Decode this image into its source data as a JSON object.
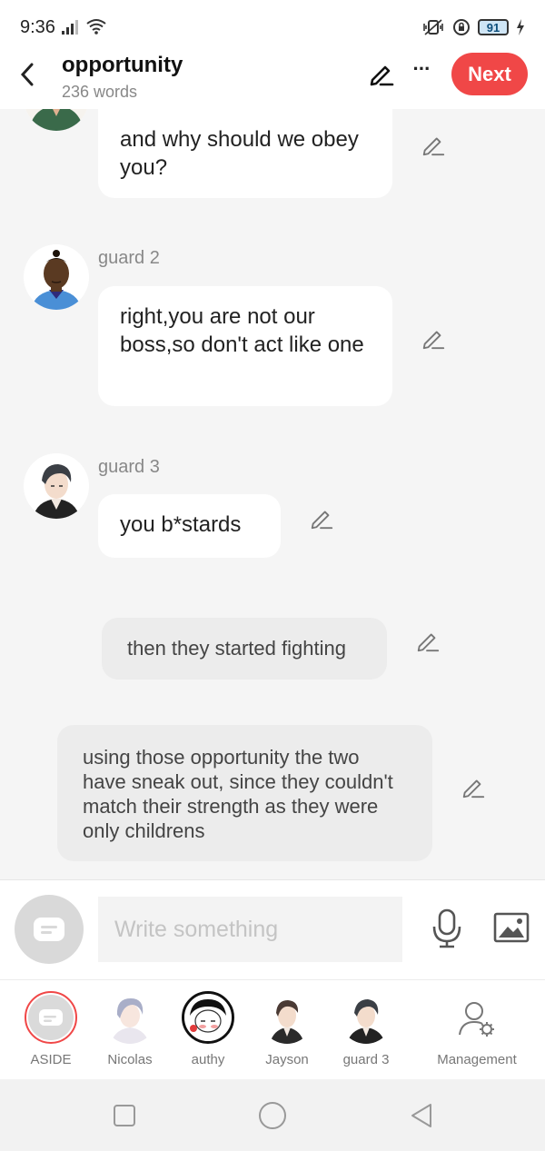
{
  "status_bar": {
    "time": "9:36",
    "battery": "91"
  },
  "header": {
    "title": "opportunity",
    "word_count": "236 words",
    "next_label": "Next",
    "more_label": "···"
  },
  "messages": [
    {
      "speaker": "",
      "text": "and why should we obey you?"
    },
    {
      "speaker": "guard 2",
      "text": "right,you are not our boss,so don't act like one"
    },
    {
      "speaker": "guard 3",
      "text": "you b*stards"
    },
    {
      "speaker": "",
      "text": "then they started fighting"
    },
    {
      "speaker": "",
      "text": "using those opportunity the two have sneak out, since they couldn't match their strength as they were only childrens"
    }
  ],
  "input": {
    "placeholder": "Write something"
  },
  "characters": [
    {
      "label": "ASIDE"
    },
    {
      "label": "Nicolas"
    },
    {
      "label": "authy"
    },
    {
      "label": "Jayson"
    },
    {
      "label": "guard 3"
    },
    {
      "label": "Management"
    }
  ],
  "colors": {
    "accent": "#f04747",
    "bubble": "#ffffff",
    "aside_bubble": "#ececec",
    "background": "#f5f5f5"
  }
}
